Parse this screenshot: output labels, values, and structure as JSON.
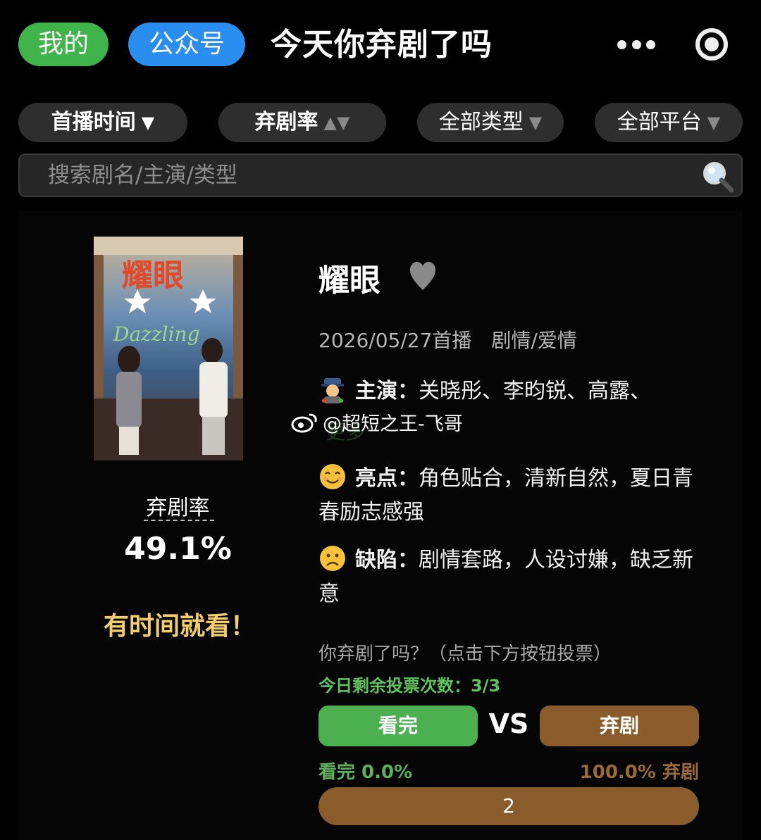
{
  "header": {
    "mine_label": "我的",
    "official_label": "公众号",
    "title": "今天你弃剧了吗"
  },
  "filters": [
    {
      "label": "首播时间",
      "arrow": "▼"
    },
    {
      "label": "弃剧率",
      "arrow": "▲▼"
    },
    {
      "label": "全部类型",
      "arrow": "▼"
    },
    {
      "label": "全部平台",
      "arrow": "▼"
    }
  ],
  "search": {
    "placeholder": "搜索剧名/主演/类型"
  },
  "drama": {
    "title": "耀眼",
    "premiere": "2026/05/27首播",
    "genre": "剧情/爱情",
    "cast_label": "主演：",
    "cast": "关晓彤、李昀锐、高露、",
    "cast_more": "更多",
    "pros_label": "亮点：",
    "pros": "角色贴合，清新自然，夏日青春励志感强",
    "cons_label": "缺陷：",
    "cons": "剧情套路，人设讨嫌，缺乏新意",
    "rate_label": "弃剧率",
    "rate_value": "49.1%",
    "verdict": "有时间就看！"
  },
  "poster_text": {
    "title_art": "耀眼",
    "english": "Dazzling"
  },
  "watermark": "@超短之王-飞哥",
  "vote": {
    "prompt": "你弃剧了吗？（点击下方按钮投票）",
    "remaining": "今日剩余投票次数：3/3",
    "watch_label": "看完",
    "vs_label": "VS",
    "drop_label": "弃剧",
    "watch_pct": "看完 0.0%",
    "drop_pct": "100.0% 弃剧",
    "drop_fraction": 1.0,
    "count": "2"
  },
  "colors": {
    "green": "#4caf50",
    "brown": "#8a5c2c",
    "blue": "#2a8ef0",
    "gold": "#f2cf6a"
  }
}
